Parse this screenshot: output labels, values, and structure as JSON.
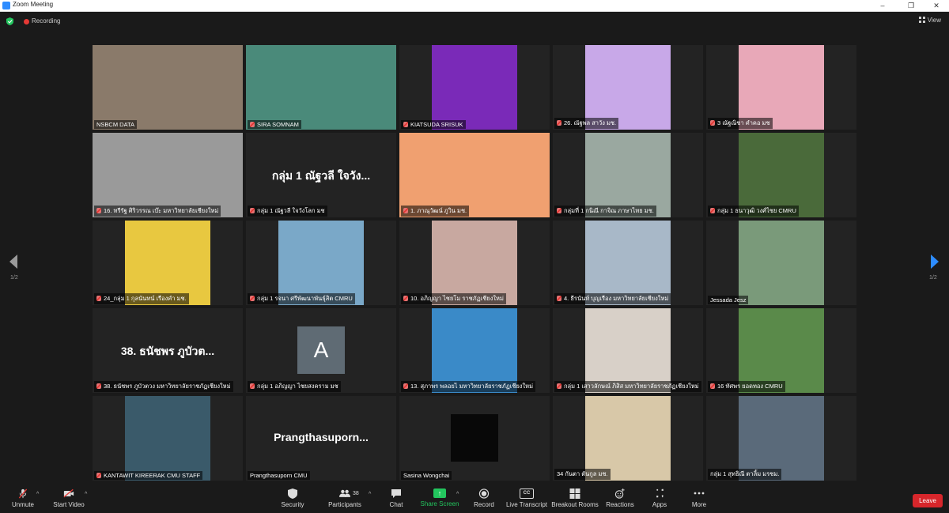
{
  "window": {
    "title": "Zoom Meeting",
    "controls": [
      "–",
      "❐",
      "✕"
    ]
  },
  "topbar": {
    "recording_label": "Recording",
    "view_label": "View"
  },
  "nav": {
    "left_page": "1/2",
    "right_page": "1/2"
  },
  "tiles": [
    {
      "name": "NSBCM DATA",
      "muted": false,
      "kind": "video",
      "bg": "#8a7a6a",
      "active": true
    },
    {
      "name": "SIRA SOMNAM",
      "muted": true,
      "kind": "video",
      "bg": "#4a8a7a"
    },
    {
      "name": "KIATSUDA SRISUK",
      "muted": true,
      "kind": "video",
      "bg": "#7a2ab8"
    },
    {
      "name": "26. ณัฐพล สาวัง มช.",
      "muted": true,
      "kind": "video",
      "bg": "#c8a8e8"
    },
    {
      "name": "3 ณัฐณิชา คำคอ มช",
      "muted": true,
      "kind": "video",
      "bg": "#e8a8b8"
    },
    {
      "name": "16. ทรีรัฐ ศิริวรรณ เบ๊ะ มหาวิทยาลัยเชียงใหม่",
      "muted": true,
      "kind": "video",
      "bg": "#9a9a9a"
    },
    {
      "name": "กลุ่ม 1 ณัฐวลี ใจวังโลก มช",
      "muted": true,
      "kind": "text",
      "text": "กลุ่ม 1 ณัฐวลี ใจวัง..."
    },
    {
      "name": "1. ภาณุวัฒน์ ภูวิน มช.",
      "muted": true,
      "kind": "video",
      "bg": "#f0a070"
    },
    {
      "name": "กลุ่มที่ 1 กนิณี กาจิณ ภาษาไทย มช.",
      "muted": true,
      "kind": "video",
      "bg": "#9aa8a0"
    },
    {
      "name": "กลุ่ม 1 ธนาวุฒิ วงศ์ไชย CMRU",
      "muted": true,
      "kind": "video",
      "bg": "#4a6a3a"
    },
    {
      "name": "24_กลุ่ม 1 กุลนันทน์ เรืองคำ มช.",
      "muted": true,
      "kind": "video",
      "bg": "#e8c840"
    },
    {
      "name": "กลุ่ม 1 รจนา ศรีพัฒนาพันธ์ุสิต CMRU",
      "muted": true,
      "kind": "video",
      "bg": "#7aa8c8"
    },
    {
      "name": "10. อภิญญา ไชยโม ราชภัฏเชียงใหม่",
      "muted": true,
      "kind": "video",
      "bg": "#c8a8a0"
    },
    {
      "name": "4. ธีรนันท์ บุญเรือง มหาวิทยาลัยเชียงใหม่",
      "muted": true,
      "kind": "video",
      "bg": "#a8b8c8"
    },
    {
      "name": "Jessada Jesz",
      "muted": false,
      "kind": "video",
      "bg": "#7a9a7a"
    },
    {
      "name": "38. ธนัชพร ภูบัวตวง มหาวิทยาลัยราชภัฏเชียงใหม่",
      "muted": true,
      "kind": "text",
      "text": "38. ธนัชพร ภูบัวต..."
    },
    {
      "name": "กลุ่ม 1 อภิญญา ไชยสงคราม มช",
      "muted": true,
      "kind": "avatar",
      "text": "A"
    },
    {
      "name": "13. สุภาพร พลอยไ มหาวิทยาลัยราชภัฏเชียงใหม่",
      "muted": true,
      "kind": "video",
      "bg": "#3a8ac8"
    },
    {
      "name": "กลุ่ม 1 เสาวลักษณ์ ภิสิส มหาวิทยาลัยราชภัฏเชียงใหม่",
      "muted": true,
      "kind": "video",
      "bg": "#d8d0c8"
    },
    {
      "name": "16 ทัศพร ยอดทอง CMRU",
      "muted": true,
      "kind": "video",
      "bg": "#5a8a4a"
    },
    {
      "name": "KANTAWIT KIREERAK CMU STAFF",
      "muted": true,
      "kind": "video",
      "bg": "#3a5a6a"
    },
    {
      "name": "Prangthasuporn CMU",
      "muted": false,
      "kind": "text",
      "text": "Prangthasuporn..."
    },
    {
      "name": "Sasina Wongchai",
      "muted": false,
      "kind": "black"
    },
    {
      "name": "34 กันตา ตันกูล มช.",
      "muted": false,
      "kind": "video",
      "bg": "#d8c8a8"
    },
    {
      "name": "กลุ่ม 1 สุทธิณี ตาลิ้ม มรชม.",
      "muted": false,
      "kind": "video",
      "bg": "#5a6a7a"
    }
  ],
  "toolbar": {
    "unmute": "Unmute",
    "start_video": "Start Video",
    "security": "Security",
    "participants": "Participants",
    "participants_count": "38",
    "chat": "Chat",
    "share_screen": "Share Screen",
    "record": "Record",
    "live_transcript": "Live Transcript",
    "live_transcript_badge": "CC",
    "breakout_rooms": "Breakout Rooms",
    "reactions": "Reactions",
    "apps": "Apps",
    "more": "More",
    "leave": "Leave"
  }
}
